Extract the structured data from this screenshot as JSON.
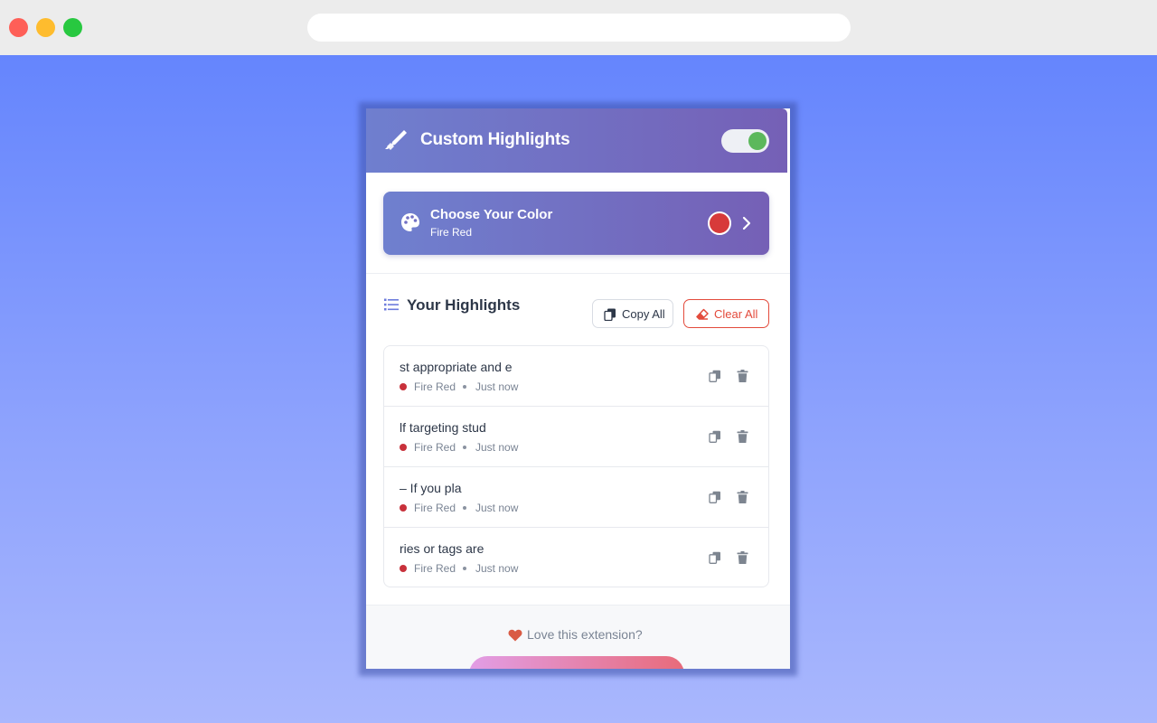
{
  "browser": {
    "address": ""
  },
  "popup": {
    "header": {
      "title": "Custom Highlights",
      "icon": "highlighter-icon",
      "enabled": true
    },
    "color_picker": {
      "title": "Choose Your Color",
      "selected_color_name": "Fire Red",
      "selected_color_hex": "#d73a3a",
      "icon": "palette-icon"
    },
    "highlights_section": {
      "title": "Your Highlights",
      "copy_all_label": "Copy All",
      "clear_all_label": "Clear All",
      "items": [
        {
          "text": "st appropriate and e",
          "color_name": "Fire Red",
          "time": "Just now"
        },
        {
          "text": "lf targeting stud",
          "color_name": "Fire Red",
          "time": "Just now"
        },
        {
          "text": "– If you pla",
          "color_name": "Fire Red",
          "time": "Just now"
        },
        {
          "text": "ries or tags are",
          "color_name": "Fire Red",
          "time": "Just now"
        }
      ]
    },
    "footer": {
      "text": "Love this extension?"
    }
  },
  "colors": {
    "header_gradient_start": "#6f7fcf",
    "header_gradient_end": "#7560b6",
    "accent_danger": "#e34a3b",
    "toggle_on": "#5cb85c",
    "highlight_dot": "#c8313b"
  }
}
